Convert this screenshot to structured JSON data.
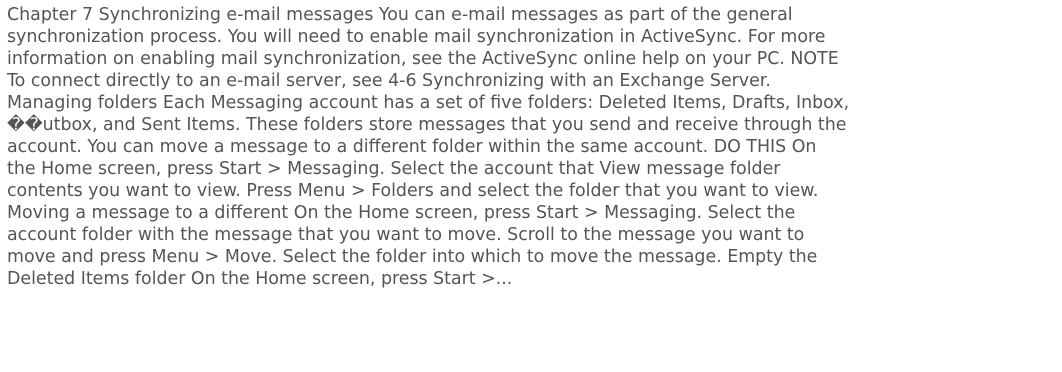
{
  "document": {
    "lines": [
      "Chapter 7 Synchronizing e-mail messages You can e-mail messages as part of the general",
      "synchronization process. You will need to enable mail synchronization in ActiveSync. For more",
      "information on enabling mail synchronization, see the ActiveSync online help on your PC. NOTE",
      "To connect directly to an e-mail server, see 4-6 Synchronizing with an Exchange Server.",
      "Managing folders Each Messaging account has a set of five folders: Deleted Items, Drafts, Inbox,",
      "��utbox, and Sent Items. These folders store messages that you send and receive through the",
      "account. You can move a message to a different folder within the same account. DO THIS On",
      "the Home screen, press Start > Messaging. Select the account that View message folder",
      "contents you want to view. Press Menu > Folders and select the folder that you want to view.",
      "Moving a message to a different On the Home screen, press Start > Messaging. Select the",
      "account folder with the message that you want to move. Scroll to the message you want to",
      "move and press Menu > Move. Select the folder into which to move the message. Empty the",
      "Deleted Items folder On the Home screen, press Start >..."
    ]
  }
}
